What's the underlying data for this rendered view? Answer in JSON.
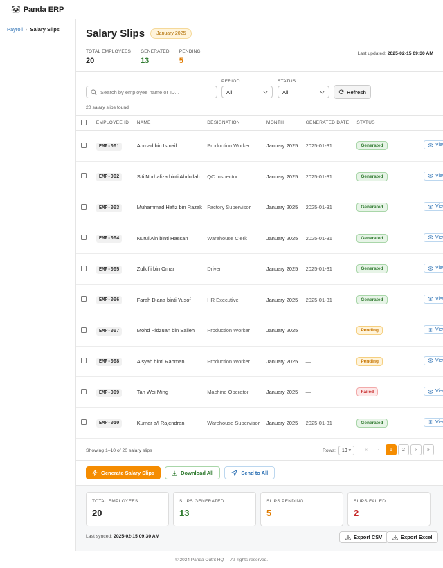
{
  "app": {
    "logo_emoji": "🐼",
    "name": "Panda ERP"
  },
  "breadcrumb": {
    "parent": "Payroll",
    "separator": "›",
    "current": "Salary Slips"
  },
  "header": {
    "title": "Salary Slips",
    "month_badge": "January 2025",
    "stats": [
      {
        "label": "TOTAL EMPLOYEES",
        "value": "20"
      },
      {
        "label": "GENERATED",
        "value": "13"
      },
      {
        "label": "PENDING",
        "value": "5"
      }
    ],
    "last_updated_label": "Last updated:",
    "last_updated_value": "2025-02-15 09:30 AM"
  },
  "filters": {
    "search_placeholder": "Search by employee name or ID...",
    "search_value": "",
    "period_label": "PERIOD",
    "period_value": "All",
    "status_label": "STATUS",
    "status_value": "All",
    "refresh_label": "Refresh",
    "found_text": "20 salary slips found"
  },
  "table": {
    "columns": [
      "EMPLOYEE ID",
      "NAME",
      "DESIGNATION",
      "MONTH",
      "GENERATED DATE",
      "STATUS"
    ],
    "view_label": "View",
    "rows": [
      {
        "id": "EMP-001",
        "name": "Ahmad bin Ismail",
        "designation": "Production Worker",
        "month": "January 2025",
        "generated": "2025-01-31",
        "status": "Generated"
      },
      {
        "id": "EMP-002",
        "name": "Siti Nurhaliza binti Abdullah",
        "designation": "QC Inspector",
        "month": "January 2025",
        "generated": "2025-01-31",
        "status": "Generated"
      },
      {
        "id": "EMP-003",
        "name": "Muhammad Hafiz bin Razak",
        "designation": "Factory Supervisor",
        "month": "January 2025",
        "generated": "2025-01-31",
        "status": "Generated"
      },
      {
        "id": "EMP-004",
        "name": "Nurul Ain binti Hassan",
        "designation": "Warehouse Clerk",
        "month": "January 2025",
        "generated": "2025-01-31",
        "status": "Generated"
      },
      {
        "id": "EMP-005",
        "name": "Zulkifli bin Omar",
        "designation": "Driver",
        "month": "January 2025",
        "generated": "2025-01-31",
        "status": "Generated"
      },
      {
        "id": "EMP-006",
        "name": "Farah Diana binti Yusof",
        "designation": "HR Executive",
        "month": "January 2025",
        "generated": "2025-01-31",
        "status": "Generated"
      },
      {
        "id": "EMP-007",
        "name": "Mohd Ridzuan bin Salleh",
        "designation": "Production Worker",
        "month": "January 2025",
        "generated": "—",
        "status": "Pending"
      },
      {
        "id": "EMP-008",
        "name": "Aisyah binti Rahman",
        "designation": "Production Worker",
        "month": "January 2025",
        "generated": "—",
        "status": "Pending"
      },
      {
        "id": "EMP-009",
        "name": "Tan Wei Ming",
        "designation": "Machine Operator",
        "month": "January 2025",
        "generated": "—",
        "status": "Failed"
      },
      {
        "id": "EMP-010",
        "name": "Kumar a/l Rajendran",
        "designation": "Warehouse Supervisor",
        "month": "January 2025",
        "generated": "2025-01-31",
        "status": "Generated"
      }
    ]
  },
  "pagination": {
    "showing": "Showing 1–10 of 20 salary slips",
    "rows_label": "Rows:",
    "rows_value": "10",
    "first": "«",
    "prev": "‹",
    "pages": [
      "1",
      "2"
    ],
    "next": "›",
    "last": "»"
  },
  "actions": {
    "generate": "Generate Salary Slips",
    "download": "Download All",
    "send": "Send to All"
  },
  "summary": {
    "cards": [
      {
        "label": "TOTAL EMPLOYEES",
        "value": "20"
      },
      {
        "label": "SLIPS GENERATED",
        "value": "13"
      },
      {
        "label": "SLIPS PENDING",
        "value": "5"
      },
      {
        "label": "SLIPS FAILED",
        "value": "2"
      }
    ],
    "synced_label": "Last synced:",
    "synced_value": "2025-02-15 09:30 AM",
    "export_csv": "Export CSV",
    "export_excel": "Export Excel"
  },
  "footer": {
    "text": "© 2024 Panda Outfit HQ — All rights reserved."
  },
  "colors": {
    "accent": "#f58c00",
    "generated": "#2f7a2f",
    "pending": "#e07b00",
    "failed": "#c62828",
    "link": "#2a6fb3"
  },
  "icons": {
    "search": "search-icon",
    "refresh": "refresh-icon",
    "chevron": "chevron-down-icon",
    "view": "eye-icon",
    "generate": "bolt-icon",
    "download": "download-icon",
    "send": "send-icon"
  }
}
